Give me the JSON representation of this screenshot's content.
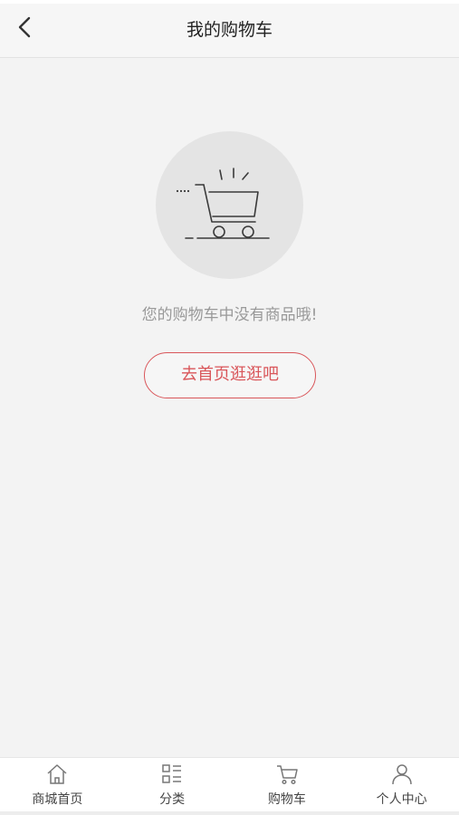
{
  "header": {
    "title": "我的购物车",
    "back_icon": "chevron-left-icon"
  },
  "empty_state": {
    "icon": "shopping-cart-icon",
    "message": "您的购物车中没有商品哦!",
    "button_label": "去首页逛逛吧"
  },
  "tabbar": {
    "items": [
      {
        "label": "商城首页",
        "icon": "home-icon"
      },
      {
        "label": "分类",
        "icon": "category-icon"
      },
      {
        "label": "购物车",
        "icon": "cart-icon"
      },
      {
        "label": "个人中心",
        "icon": "user-icon"
      }
    ]
  },
  "colors": {
    "accent": "#d9565a",
    "page_background": "#f3f3f3",
    "muted_text": "#999999"
  }
}
